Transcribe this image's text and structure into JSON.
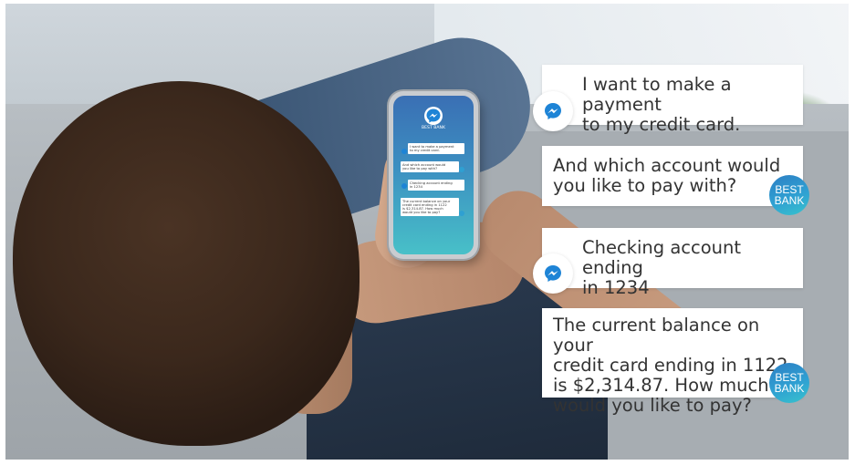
{
  "brand": {
    "name_line1": "BEST",
    "name_line2": "BANK",
    "phone_label": "BEST BANK",
    "accent": "#2fa0d2",
    "messenger_blue": "#1e84d6"
  },
  "chat": {
    "messages": [
      {
        "sender": "user",
        "text": "I want to make a payment\nto my credit card."
      },
      {
        "sender": "bank",
        "text": "And which account would\nyou like to pay with?"
      },
      {
        "sender": "user",
        "text": "Checking account ending\nin 1234"
      },
      {
        "sender": "bank",
        "text": "The current balance on your\ncredit card ending in 1122\nis $2,314.87. How much\nwould you like to pay?"
      }
    ]
  },
  "phone_chat": {
    "messages": [
      {
        "text": "I want to make a payment\nto my credit card."
      },
      {
        "text": "And which account would\nyou like to pay with?"
      },
      {
        "text": "Checking account ending\nin 1234"
      },
      {
        "text": "The current balance on your\ncredit card ending in 1122\nis $2,314.87. How much\nwould you like to pay?"
      }
    ]
  },
  "icons": {
    "messenger": "messenger-icon",
    "bank": "best-bank-logo"
  }
}
